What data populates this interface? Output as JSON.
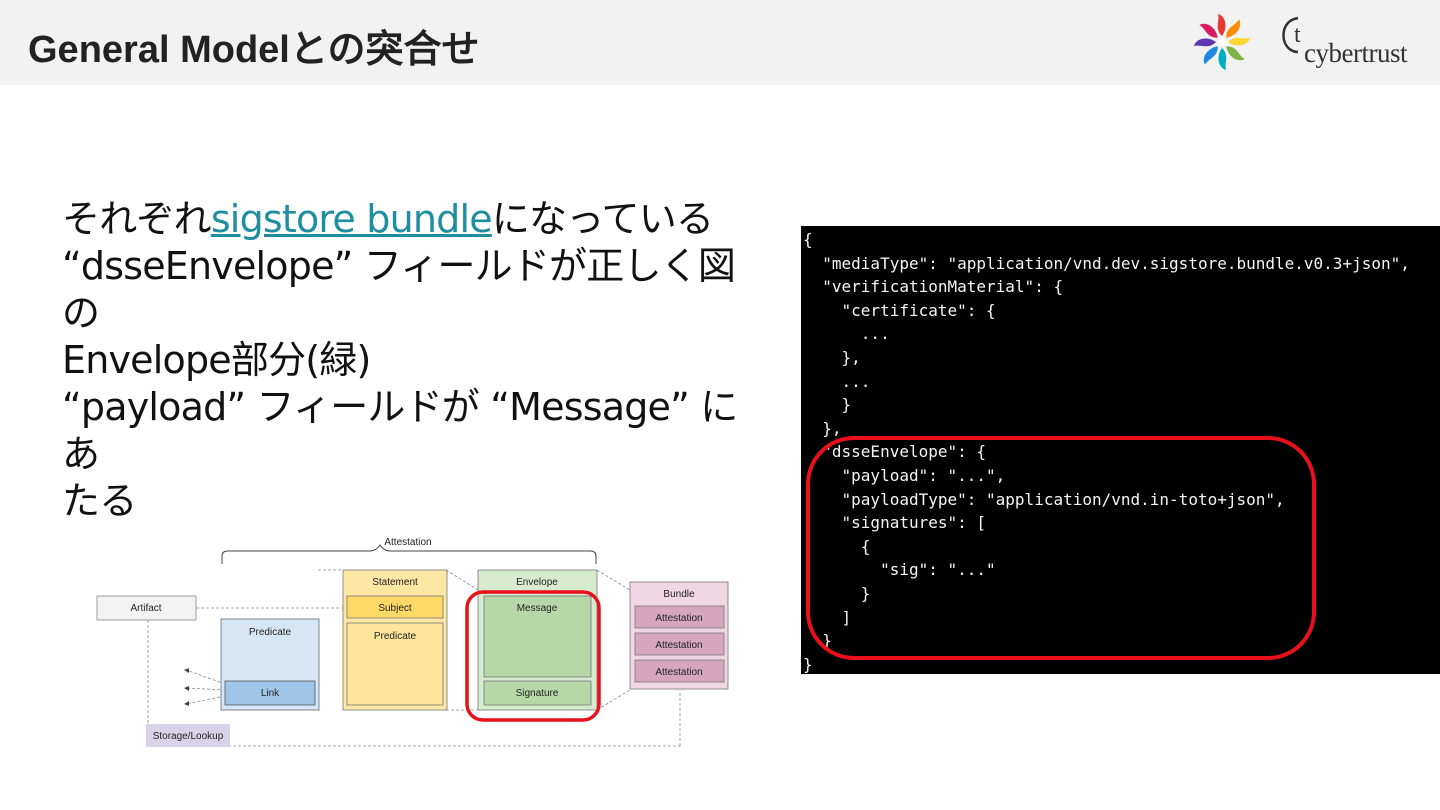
{
  "header": {
    "title": "General Modelとの突合せ",
    "logo_text": "cybertrust"
  },
  "body": {
    "line1_pre": "それぞれ",
    "line1_link": "sigstore bundle",
    "line1_post": "になっている",
    "line2": "“dsseEnvelope” フィールドが正しく図の",
    "line3": "Envelope部分(緑)",
    "line4": "“payload” フィールドが “Message” にあ",
    "line5": "たる"
  },
  "code": {
    "lines": [
      "{",
      "  \"mediaType\": \"application/vnd.dev.sigstore.bundle.v0.3+json\",",
      "  \"verificationMaterial\": {",
      "    \"certificate\": {",
      "      ...",
      "    },",
      "    ...",
      "    }",
      "  },",
      "  \"dsseEnvelope\": {",
      "    \"payload\": \"...\",",
      "    \"payloadType\": \"application/vnd.in-toto+json\",",
      "    \"signatures\": [",
      "      {",
      "        \"sig\": \"...\"",
      "      }",
      "    ]",
      "  }",
      "}"
    ]
  },
  "diagram": {
    "attestation_label": "Attestation",
    "artifact": "Artifact",
    "predicate_left": "Predicate",
    "link": "Link",
    "storage": "Storage/Lookup",
    "statement": "Statement",
    "subject": "Subject",
    "predicate": "Predicate",
    "envelope": "Envelope",
    "message": "Message",
    "signature": "Signature",
    "bundle": "Bundle",
    "bundle_items": [
      "Attestation",
      "Attestation",
      "Attestation"
    ]
  },
  "colors": {
    "accent_link": "#1f8ea0",
    "highlight_red": "#e8101b",
    "statement_fill": "#fde7a4",
    "envelope_fill": "#d7ebcf",
    "predicate_fill": "#d7e6f5",
    "bundle_fill": "#f1d6e4",
    "storage_fill": "#d9d2e9"
  }
}
